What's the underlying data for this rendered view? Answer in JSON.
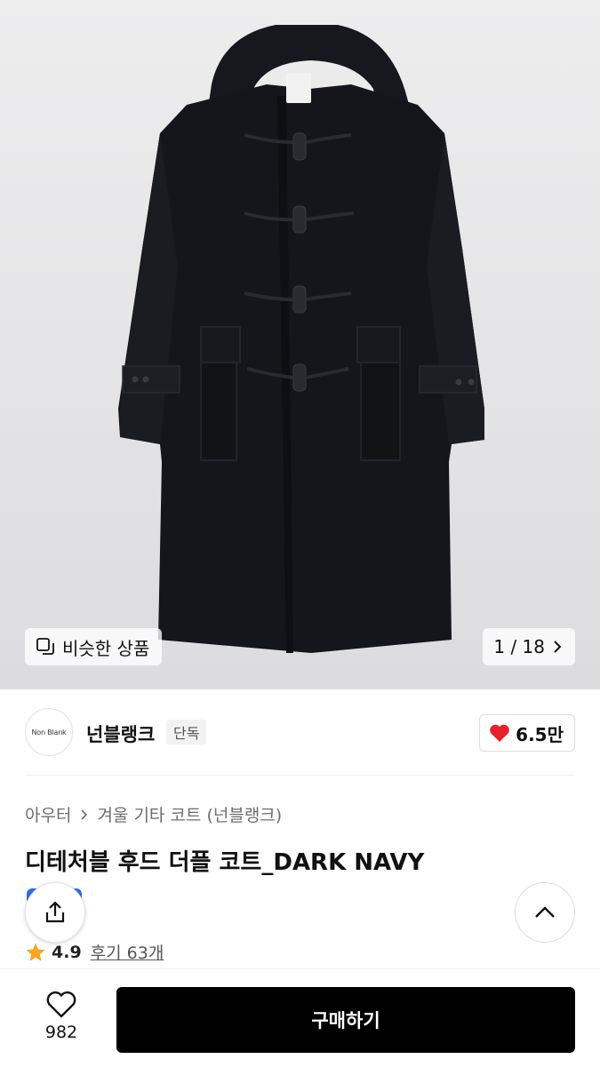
{
  "gallery": {
    "similar_label": "비슷한 상품",
    "counter": "1 / 18"
  },
  "brand": {
    "logo_text": "Non Blank",
    "name": "넌블랭크",
    "badge": "단독",
    "likes": "6.5만",
    "heart_color": "#e8202a"
  },
  "product": {
    "breadcrumb": [
      "아우터",
      "겨울 기타 코트 (넌블랭크)"
    ],
    "title": "디테처블 후드 더플 코트_DARK NAVY",
    "rating": "4.9",
    "reviews": "후기 63개",
    "star_color": "#f5a623"
  },
  "bottom_bar": {
    "wish_count": "982",
    "buy_label": "구매하기"
  },
  "icons": [
    "similar-icon",
    "chevron-right-icon",
    "heart-icon",
    "share-icon",
    "chevron-up-icon",
    "star-icon"
  ]
}
